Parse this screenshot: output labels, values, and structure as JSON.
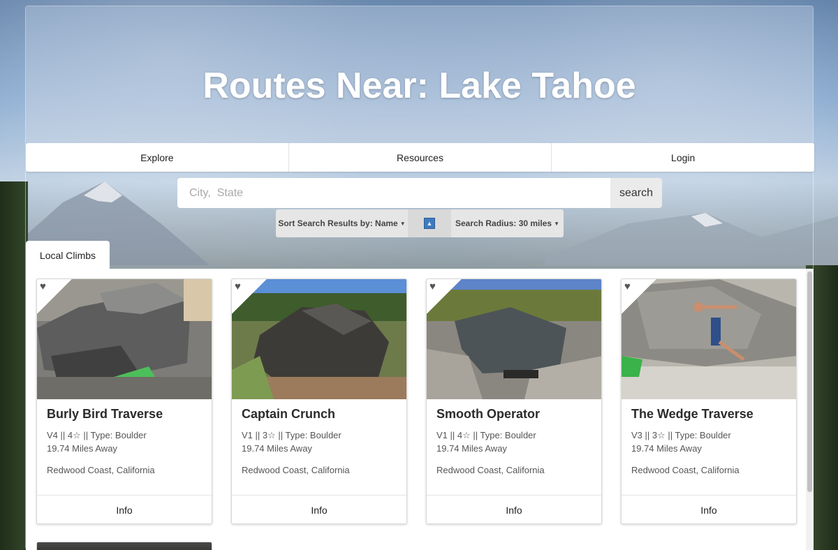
{
  "hero": {
    "title": "Routes Near: Lake Tahoe"
  },
  "nav": {
    "items": [
      "Explore",
      "Resources",
      "Login"
    ]
  },
  "search": {
    "placeholder": "City,  State",
    "value": "",
    "button_label": "search"
  },
  "sort": {
    "sort_label": "Sort Search Results by: Name",
    "direction_icon": "sort-ascending-icon",
    "radius_label": "Search Radius: 30 miles"
  },
  "tabs": {
    "active": "Local Climbs"
  },
  "routes": [
    {
      "name": "Burly Bird Traverse",
      "grade": "V4 || 4",
      "type": "|| Type: Boulder",
      "distance": "19.74 Miles Away",
      "location": "Redwood Coast, California",
      "info_label": "Info"
    },
    {
      "name": "Captain Crunch",
      "grade": "V1 || 3",
      "type": "|| Type: Boulder",
      "distance": "19.74 Miles Away",
      "location": "Redwood Coast, California",
      "info_label": "Info"
    },
    {
      "name": "Smooth Operator",
      "grade": "V1 || 4",
      "type": "|| Type: Boulder",
      "distance": "19.74 Miles Away",
      "location": "Redwood Coast, California",
      "info_label": "Info"
    },
    {
      "name": "The Wedge Traverse",
      "grade": "V3 || 3",
      "type": "|| Type: Boulder",
      "distance": "19.74 Miles Away",
      "location": "Redwood Coast, California",
      "info_label": "Info"
    }
  ],
  "colors": {
    "brand_text": "#ffffff",
    "direction_icon": "#3e7bbf"
  }
}
